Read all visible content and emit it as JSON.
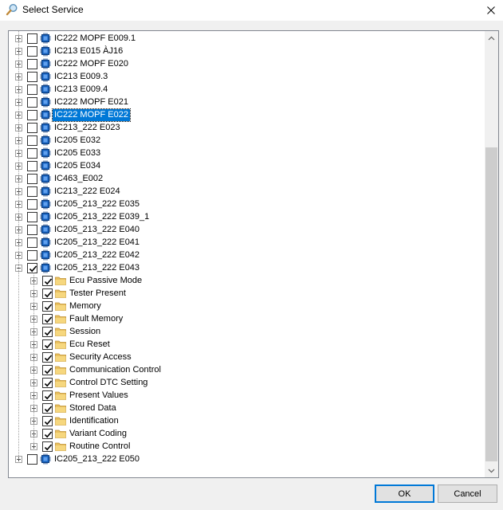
{
  "window": {
    "title": "Select Service"
  },
  "colors": {
    "accent": "#0078d7",
    "folder": "#e8c060",
    "chip": "#1560bd"
  },
  "tree": {
    "items": [
      {
        "label": "IC222 MOPF E009.1",
        "level": 0,
        "kind": "ecu",
        "checked": false,
        "expanded": false
      },
      {
        "label": "IC213 E015 ÀJ16",
        "level": 0,
        "kind": "ecu",
        "checked": false,
        "expanded": false
      },
      {
        "label": "IC222 MOPF E020",
        "level": 0,
        "kind": "ecu",
        "checked": false,
        "expanded": false
      },
      {
        "label": "IC213 E009.3",
        "level": 0,
        "kind": "ecu",
        "checked": false,
        "expanded": false
      },
      {
        "label": "IC213 E009.4",
        "level": 0,
        "kind": "ecu",
        "checked": false,
        "expanded": false
      },
      {
        "label": "IC222 MOPF E021",
        "level": 0,
        "kind": "ecu",
        "checked": false,
        "expanded": false
      },
      {
        "label": "IC222 MOPF E022",
        "level": 0,
        "kind": "ecu",
        "checked": false,
        "expanded": false,
        "selected": true
      },
      {
        "label": "IC213_222 E023",
        "level": 0,
        "kind": "ecu",
        "checked": false,
        "expanded": false
      },
      {
        "label": "IC205 E032",
        "level": 0,
        "kind": "ecu",
        "checked": false,
        "expanded": false
      },
      {
        "label": "IC205 E033",
        "level": 0,
        "kind": "ecu",
        "checked": false,
        "expanded": false
      },
      {
        "label": "IC205 E034",
        "level": 0,
        "kind": "ecu",
        "checked": false,
        "expanded": false
      },
      {
        "label": "IC463_E002",
        "level": 0,
        "kind": "ecu",
        "checked": false,
        "expanded": false
      },
      {
        "label": "IC213_222 E024",
        "level": 0,
        "kind": "ecu",
        "checked": false,
        "expanded": false
      },
      {
        "label": "IC205_213_222 E035",
        "level": 0,
        "kind": "ecu",
        "checked": false,
        "expanded": false
      },
      {
        "label": "IC205_213_222 E039_1",
        "level": 0,
        "kind": "ecu",
        "checked": false,
        "expanded": false
      },
      {
        "label": "IC205_213_222 E040",
        "level": 0,
        "kind": "ecu",
        "checked": false,
        "expanded": false
      },
      {
        "label": "IC205_213_222 E041",
        "level": 0,
        "kind": "ecu",
        "checked": false,
        "expanded": false
      },
      {
        "label": "IC205_213_222 E042",
        "level": 0,
        "kind": "ecu",
        "checked": false,
        "expanded": false
      },
      {
        "label": "IC205_213_222 E043",
        "level": 0,
        "kind": "ecu",
        "checked": true,
        "expanded": true
      },
      {
        "label": "Ecu Passive Mode",
        "level": 1,
        "kind": "folder",
        "checked": true,
        "expanded": false
      },
      {
        "label": "Tester Present",
        "level": 1,
        "kind": "folder",
        "checked": true,
        "expanded": false
      },
      {
        "label": "Memory",
        "level": 1,
        "kind": "folder",
        "checked": true,
        "expanded": false
      },
      {
        "label": "Fault Memory",
        "level": 1,
        "kind": "folder",
        "checked": true,
        "expanded": false
      },
      {
        "label": "Session",
        "level": 1,
        "kind": "folder",
        "checked": true,
        "expanded": false
      },
      {
        "label": "Ecu Reset",
        "level": 1,
        "kind": "folder",
        "checked": true,
        "expanded": false
      },
      {
        "label": "Security Access",
        "level": 1,
        "kind": "folder",
        "checked": true,
        "expanded": false
      },
      {
        "label": "Communication Control",
        "level": 1,
        "kind": "folder",
        "checked": true,
        "expanded": false
      },
      {
        "label": "Control DTC Setting",
        "level": 1,
        "kind": "folder",
        "checked": true,
        "expanded": false
      },
      {
        "label": "Present Values",
        "level": 1,
        "kind": "folder",
        "checked": true,
        "expanded": false
      },
      {
        "label": "Stored Data",
        "level": 1,
        "kind": "folder",
        "checked": true,
        "expanded": false
      },
      {
        "label": "Identification",
        "level": 1,
        "kind": "folder",
        "checked": true,
        "expanded": false
      },
      {
        "label": "Variant Coding",
        "level": 1,
        "kind": "folder",
        "checked": true,
        "expanded": false
      },
      {
        "label": "Routine Control",
        "level": 1,
        "kind": "folder",
        "checked": true,
        "expanded": false
      },
      {
        "label": "IC205_213_222 E050",
        "level": 0,
        "kind": "ecu",
        "checked": false,
        "expanded": false
      }
    ]
  },
  "buttons": {
    "ok": "OK",
    "cancel": "Cancel"
  },
  "icons": {
    "title": "magnifier-icon",
    "close": "close-icon",
    "ecu": "chip-icon",
    "folder": "folder-icon"
  }
}
